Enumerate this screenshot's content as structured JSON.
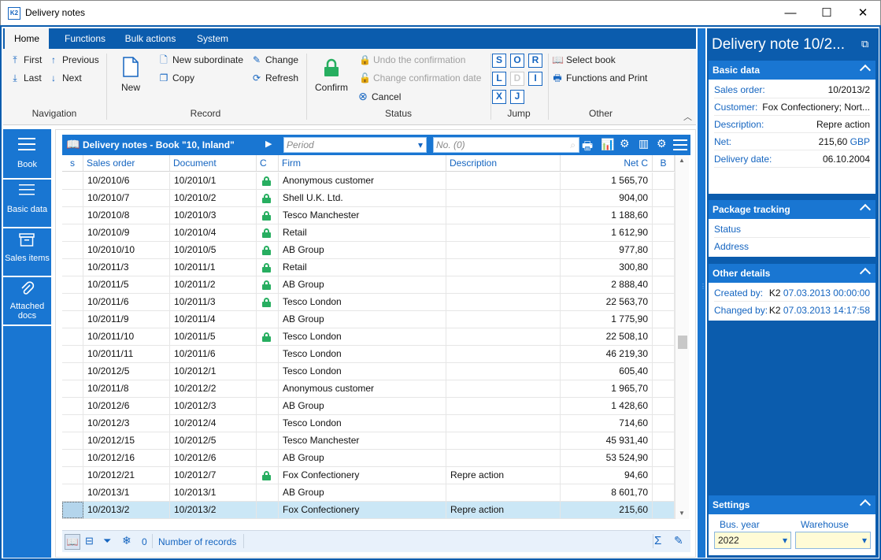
{
  "window": {
    "title": "Delivery notes",
    "icon": "K2",
    "minimize": "—",
    "maximize": "☐",
    "close": "✕"
  },
  "ribbon": {
    "tabs": [
      "Home",
      "Functions",
      "Bulk actions",
      "System"
    ],
    "navigation": {
      "first": "First",
      "previous": "Previous",
      "last": "Last",
      "next": "Next",
      "label": "Navigation"
    },
    "record": {
      "new": "New",
      "new_subordinate": "New subordinate",
      "change": "Change",
      "copy": "Copy",
      "refresh": "Refresh",
      "label": "Record"
    },
    "status": {
      "confirm": "Confirm",
      "undo": "Undo the confirmation",
      "change_date": "Change confirmation date",
      "cancel": "Cancel",
      "label": "Status"
    },
    "jump": {
      "keys": [
        "S",
        "O",
        "R",
        "L",
        "D",
        "I",
        "X",
        "J"
      ],
      "label": "Jump"
    },
    "other": {
      "select_book": "Select book",
      "functions_print": "Functions and Print",
      "label": "Other"
    }
  },
  "leftnav": [
    {
      "label": "Book"
    },
    {
      "label": "Basic data"
    },
    {
      "label": "Sales items"
    },
    {
      "label": "Attached docs"
    }
  ],
  "grid": {
    "title": "Delivery notes - Book \"10, Inland\"",
    "period_placeholder": "Period",
    "number_placeholder": "No. (0)",
    "columns": [
      "s",
      "Sales order",
      "Document",
      "C",
      "Firm",
      "Description",
      "Net C",
      "B"
    ],
    "rows": [
      {
        "so": "10/2010/6",
        "doc": "10/2010/1",
        "lock": true,
        "firm": "Anonymous customer",
        "desc": "",
        "net": "1 565,70"
      },
      {
        "so": "10/2010/7",
        "doc": "10/2010/2",
        "lock": true,
        "firm": "Shell U.K. Ltd.",
        "desc": "",
        "net": "904,00"
      },
      {
        "so": "10/2010/8",
        "doc": "10/2010/3",
        "lock": true,
        "firm": "Tesco Manchester",
        "desc": "",
        "net": "1 188,60"
      },
      {
        "so": "10/2010/9",
        "doc": "10/2010/4",
        "lock": true,
        "firm": "Retail",
        "desc": "",
        "net": "1 612,90"
      },
      {
        "so": "10/2010/10",
        "doc": "10/2010/5",
        "lock": true,
        "firm": "AB Group",
        "desc": "",
        "net": "977,80"
      },
      {
        "so": "10/2011/3",
        "doc": "10/2011/1",
        "lock": true,
        "firm": "Retail",
        "desc": "",
        "net": "300,80"
      },
      {
        "so": "10/2011/5",
        "doc": "10/2011/2",
        "lock": true,
        "firm": "AB Group",
        "desc": "",
        "net": "2 888,40"
      },
      {
        "so": "10/2011/6",
        "doc": "10/2011/3",
        "lock": true,
        "firm": "Tesco London",
        "desc": "",
        "net": "22 563,70"
      },
      {
        "so": "10/2011/9",
        "doc": "10/2011/4",
        "lock": false,
        "firm": "AB Group",
        "desc": "",
        "net": "1 775,90"
      },
      {
        "so": "10/2011/10",
        "doc": "10/2011/5",
        "lock": true,
        "firm": "Tesco London",
        "desc": "",
        "net": "22 508,10"
      },
      {
        "so": "10/2011/11",
        "doc": "10/2011/6",
        "lock": false,
        "firm": "Tesco London",
        "desc": "",
        "net": "46 219,30"
      },
      {
        "so": "10/2012/5",
        "doc": "10/2012/1",
        "lock": false,
        "firm": "Tesco London",
        "desc": "",
        "net": "605,40"
      },
      {
        "so": "10/2011/8",
        "doc": "10/2012/2",
        "lock": false,
        "firm": "Anonymous customer",
        "desc": "",
        "net": "1 965,70"
      },
      {
        "so": "10/2012/6",
        "doc": "10/2012/3",
        "lock": false,
        "firm": "AB Group",
        "desc": "",
        "net": "1 428,60"
      },
      {
        "so": "10/2012/3",
        "doc": "10/2012/4",
        "lock": false,
        "firm": "Tesco London",
        "desc": "",
        "net": "714,60"
      },
      {
        "so": "10/2012/15",
        "doc": "10/2012/5",
        "lock": false,
        "firm": "Tesco Manchester",
        "desc": "",
        "net": "45 931,40"
      },
      {
        "so": "10/2012/16",
        "doc": "10/2012/6",
        "lock": false,
        "firm": "AB Group",
        "desc": "",
        "net": "53 524,90"
      },
      {
        "so": "10/2012/21",
        "doc": "10/2012/7",
        "lock": true,
        "firm": "Fox Confectionery",
        "desc": "Repre action",
        "net": "94,60"
      },
      {
        "so": "10/2013/1",
        "doc": "10/2013/1",
        "lock": false,
        "firm": "AB Group",
        "desc": "",
        "net": "8 601,70"
      },
      {
        "so": "10/2013/2",
        "doc": "10/2013/2",
        "lock": false,
        "firm": "Fox Confectionery",
        "desc": "Repre action",
        "net": "215,60"
      }
    ],
    "status": {
      "count": "0",
      "records_label": "Number of records"
    }
  },
  "panel": {
    "title": "Delivery note 10/2...",
    "basic": {
      "header": "Basic data",
      "items": [
        {
          "k": "Sales order:",
          "v": "10/2013/2"
        },
        {
          "k": "Customer:",
          "v": "Fox Confectionery; Nort..."
        },
        {
          "k": "Description:",
          "v": "Repre action"
        },
        {
          "k": "Net:",
          "v": "215,60",
          "cur": "GBP"
        },
        {
          "k": "Delivery date:",
          "v": "06.10.2004"
        }
      ]
    },
    "package": {
      "header": "Package tracking",
      "items": [
        "Status",
        "Address"
      ]
    },
    "other": {
      "header": "Other details",
      "items": [
        {
          "k": "Created by:",
          "user": "K2",
          "v": "07.03.2013 00:00:00"
        },
        {
          "k": "Changed by:",
          "user": "K2",
          "v": "07.03.2013 14:17:58"
        }
      ]
    },
    "settings": {
      "header": "Settings",
      "bus_year_label": "Bus. year",
      "bus_year": "2022",
      "warehouse_label": "Warehouse",
      "warehouse": ""
    }
  }
}
